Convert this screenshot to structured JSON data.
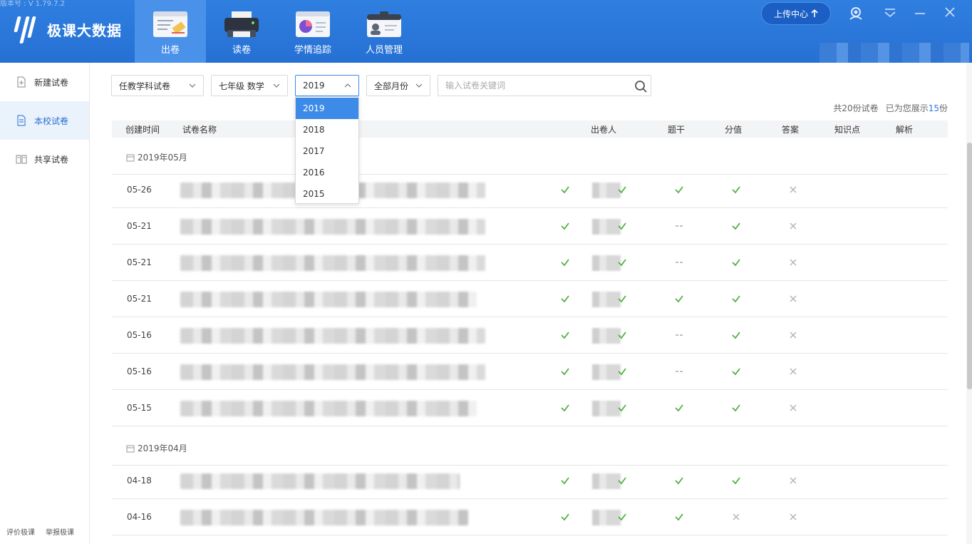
{
  "app": {
    "version": "版本号 : V 1.79.7.2",
    "logo_text": "极课大数据"
  },
  "nav": {
    "items": [
      {
        "label": "出卷",
        "icon": "paper-edit-icon",
        "active": true
      },
      {
        "label": "读卷",
        "icon": "printer-icon",
        "active": false
      },
      {
        "label": "学情追踪",
        "icon": "report-chart-icon",
        "active": false
      },
      {
        "label": "人员管理",
        "icon": "id-card-icon",
        "active": false
      }
    ]
  },
  "header": {
    "upload_label": "上传中心",
    "upload_icon": "arrow-up-icon"
  },
  "sidebar": {
    "items": [
      {
        "label": "新建试卷",
        "icon": "new-doc-icon",
        "active": false
      },
      {
        "label": "本校试卷",
        "icon": "doc-icon",
        "active": true
      },
      {
        "label": "共享试卷",
        "icon": "book-icon",
        "active": false
      }
    ],
    "footer": [
      "评价极课",
      "举报极课"
    ]
  },
  "filters": {
    "subject_type": "任教学科试卷",
    "grade_subject": "七年级 数学",
    "year": "2019",
    "month": "全部月份",
    "search_placeholder": "输入试卷关键词",
    "year_options": [
      "2019",
      "2018",
      "2017",
      "2016",
      "2015"
    ]
  },
  "summary": {
    "total": "共20份试卷",
    "shown_prefix": "已为您展示",
    "shown_count": "15",
    "shown_suffix": "份"
  },
  "table": {
    "headers": {
      "date": "创建时间",
      "name": "试卷名称",
      "author": "出卷人",
      "stem": "题干",
      "score": "分值",
      "answer": "答案",
      "knowledge": "知识点",
      "analysis": "解析"
    },
    "groups": [
      {
        "title": "2019年05月",
        "rows": [
          {
            "date": "05-26",
            "stem": "check",
            "score": "check",
            "answer": "check",
            "knowledge": "check",
            "analysis": "cross"
          },
          {
            "date": "05-21",
            "stem": "check",
            "score": "check",
            "answer": "--",
            "knowledge": "check",
            "analysis": "cross"
          },
          {
            "date": "05-21",
            "stem": "check",
            "score": "check",
            "answer": "--",
            "knowledge": "check",
            "analysis": "cross"
          },
          {
            "date": "05-21",
            "stem": "check",
            "score": "check",
            "answer": "check",
            "knowledge": "check",
            "analysis": "cross"
          },
          {
            "date": "05-16",
            "stem": "check",
            "score": "check",
            "answer": "--",
            "knowledge": "check",
            "analysis": "cross"
          },
          {
            "date": "05-16",
            "stem": "check",
            "score": "check",
            "answer": "--",
            "knowledge": "check",
            "analysis": "cross"
          },
          {
            "date": "05-15",
            "stem": "check",
            "score": "check",
            "answer": "check",
            "knowledge": "check",
            "analysis": "cross"
          }
        ]
      },
      {
        "title": "2019年04月",
        "rows": [
          {
            "date": "04-18",
            "stem": "check",
            "score": "check",
            "answer": "check",
            "knowledge": "check",
            "analysis": "cross"
          },
          {
            "date": "04-16",
            "stem": "check",
            "score": "check",
            "answer": "check",
            "knowledge": "cross",
            "analysis": "cross"
          }
        ]
      }
    ]
  },
  "colors": {
    "header_bg": "#2a74d8",
    "accent": "#3d8be8",
    "check": "#52b043",
    "cross": "#b5b5b5"
  }
}
